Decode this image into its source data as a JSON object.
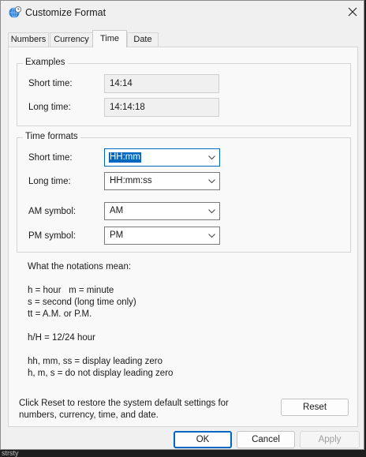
{
  "window": {
    "title": "Customize Format"
  },
  "tabs": [
    {
      "label": "Numbers"
    },
    {
      "label": "Currency"
    },
    {
      "label": "Time"
    },
    {
      "label": "Date"
    }
  ],
  "examples": {
    "title": "Examples",
    "short_label": "Short time:",
    "short_value": "14:14",
    "long_label": "Long time:",
    "long_value": "14:14:18"
  },
  "formats": {
    "title": "Time formats",
    "short_label": "Short time:",
    "short_value": "HH:mm",
    "long_label": "Long time:",
    "long_value": "HH:mm:ss",
    "am_label": "AM symbol:",
    "am_value": "AM",
    "pm_label": "PM symbol:",
    "pm_value": "PM"
  },
  "notations": {
    "heading": "What the notations mean:",
    "line1": "h = hour   m = minute",
    "line2": "s = second (long time only)",
    "line3": "tt = A.M. or P.M.",
    "line4": "h/H = 12/24 hour",
    "line5": "hh, mm, ss = display leading zero",
    "line6": "h, m, s = do not display leading zero"
  },
  "reset": {
    "text_line1": "Click Reset to restore the system default settings for",
    "text_line2": "numbers, currency, time, and date.",
    "button_label": "Reset"
  },
  "footer": {
    "ok_label": "OK",
    "cancel_label": "Cancel",
    "apply_label": "Apply"
  },
  "background_text": "strsty"
}
